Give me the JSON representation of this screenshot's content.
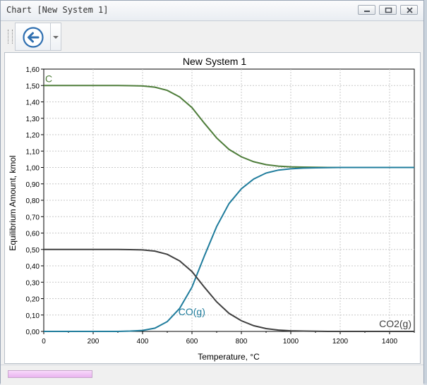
{
  "window": {
    "title": "Chart [New System 1]"
  },
  "toolbar": {
    "back_icon": "back-arrow-icon",
    "dropdown_icon": "chevron-down-icon"
  },
  "colors": {
    "C": "#4e7d3a",
    "CO": "#1f7c9c",
    "CO2": "#404040",
    "grid": "#c8c8c8",
    "progress": "#eebff2"
  },
  "status": {
    "progress_fraction": 1.0
  },
  "chart_data": {
    "type": "line",
    "title": "New System 1",
    "xlabel": "Temperature, °C",
    "ylabel": "Equilibrium Amount, kmol",
    "xlim": [
      0,
      1500
    ],
    "ylim": [
      0,
      1.6
    ],
    "grid": true,
    "x_ticks": [
      "0",
      "200",
      "400",
      "600",
      "800",
      "1000",
      "1200",
      "1400"
    ],
    "y_ticks": [
      "0,00",
      "0,10",
      "0,20",
      "0,30",
      "0,40",
      "0,50",
      "0,60",
      "0,70",
      "0,80",
      "0,90",
      "1,00",
      "1,10",
      "1,20",
      "1,30",
      "1,40",
      "1,50",
      "1,60"
    ],
    "series": [
      {
        "name": "C",
        "color_key": "C",
        "label_pos": "left-top",
        "x": [
          0,
          100,
          200,
          300,
          350,
          400,
          450,
          500,
          550,
          600,
          650,
          700,
          750,
          800,
          850,
          900,
          950,
          1000,
          1050,
          1100,
          1150,
          1200,
          1300,
          1400,
          1500
        ],
        "y": [
          1.5,
          1.5,
          1.5,
          1.5,
          1.499,
          1.497,
          1.49,
          1.47,
          1.43,
          1.365,
          1.27,
          1.18,
          1.11,
          1.065,
          1.035,
          1.017,
          1.008,
          1.004,
          1.002,
          1.001,
          1.0,
          1.0,
          1.0,
          1.0,
          1.0
        ]
      },
      {
        "name": "CO(g)",
        "color_key": "CO",
        "label_pos": "mid",
        "x": [
          0,
          100,
          200,
          300,
          350,
          400,
          450,
          500,
          550,
          600,
          650,
          700,
          750,
          800,
          850,
          900,
          950,
          1000,
          1050,
          1100,
          1150,
          1200,
          1300,
          1400,
          1500
        ],
        "y": [
          0.0,
          0.0,
          0.0,
          0.0,
          0.002,
          0.006,
          0.02,
          0.06,
          0.14,
          0.27,
          0.46,
          0.64,
          0.78,
          0.87,
          0.93,
          0.966,
          0.984,
          0.992,
          0.996,
          0.998,
          0.999,
          1.0,
          1.0,
          1.0,
          1.0
        ]
      },
      {
        "name": "CO2(g)",
        "color_key": "CO2",
        "label_pos": "right-bottom",
        "x": [
          0,
          100,
          200,
          300,
          350,
          400,
          450,
          500,
          550,
          600,
          650,
          700,
          750,
          800,
          850,
          900,
          950,
          1000,
          1050,
          1100,
          1150,
          1200,
          1300,
          1400,
          1500
        ],
        "y": [
          0.5,
          0.5,
          0.5,
          0.5,
          0.499,
          0.497,
          0.49,
          0.47,
          0.43,
          0.365,
          0.27,
          0.18,
          0.11,
          0.065,
          0.035,
          0.017,
          0.008,
          0.004,
          0.002,
          0.001,
          0.0,
          0.0,
          0.0,
          0.0,
          0.0
        ]
      }
    ]
  }
}
